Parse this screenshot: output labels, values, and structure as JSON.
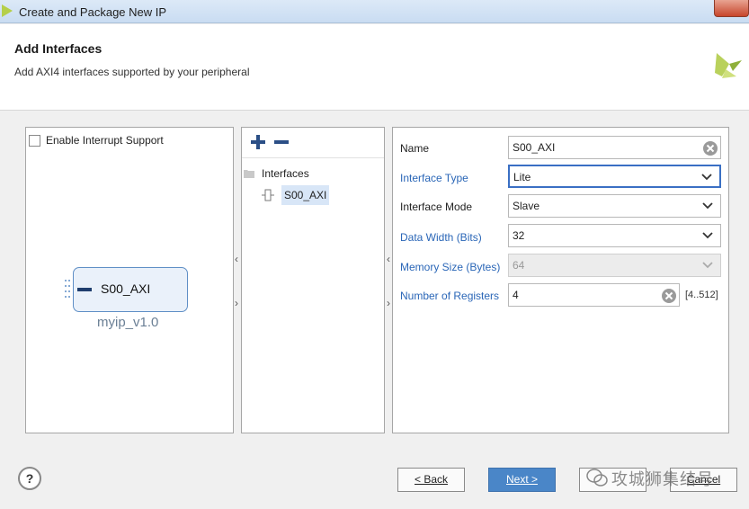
{
  "window": {
    "title": "Create and Package New IP"
  },
  "header": {
    "title": "Add Interfaces",
    "subtitle": "Add AXI4 interfaces supported by your peripheral"
  },
  "left_panel": {
    "interrupt_label": "Enable Interrupt Support",
    "interrupt_checked": false,
    "ip_block": {
      "port_label": "S00_AXI",
      "name": "myip_v1.0"
    }
  },
  "middle_panel": {
    "tree_root": "Interfaces",
    "tree_item": "S00_AXI"
  },
  "properties": {
    "name_label": "Name",
    "name_value": "S00_AXI",
    "type_label": "Interface Type",
    "type_value": "Lite",
    "mode_label": "Interface Mode",
    "mode_value": "Slave",
    "width_label": "Data Width (Bits)",
    "width_value": "32",
    "memsize_label": "Memory Size (Bytes)",
    "memsize_value": "64",
    "regs_label": "Number of Registers",
    "regs_value": "4",
    "regs_range": "[4..512]"
  },
  "footer": {
    "help": "?",
    "back": "< Back",
    "next": "Next >",
    "cancel": "Cancel",
    "watermark": "攻城狮集结号"
  },
  "colors": {
    "accent": "#4a86c8",
    "link": "#2a66b7",
    "logo_green": "#a8c94f"
  }
}
